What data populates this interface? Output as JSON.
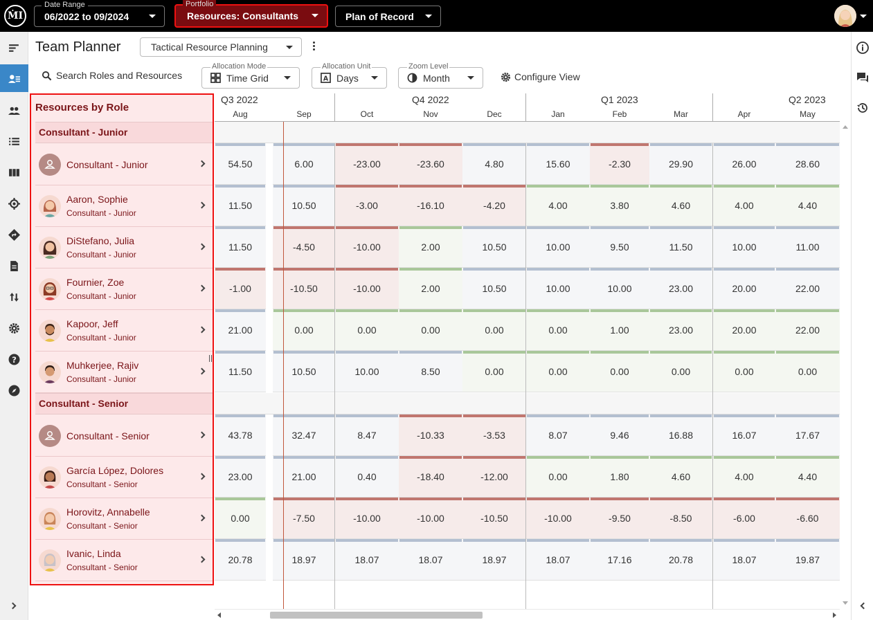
{
  "app": {
    "logo_text": "ṀI"
  },
  "topbar": {
    "date_range": {
      "label": "Date Range",
      "value": "06/2022 to 09/2024"
    },
    "portfolio": {
      "label": "Portfolio",
      "value": "Resources: Consultants"
    },
    "plan": {
      "value": "Plan of Record"
    }
  },
  "header": {
    "title": "Team Planner",
    "view": "Tactical Resource Planning"
  },
  "toolbar": {
    "search_label": "Search Roles and Resources",
    "allocation_mode": {
      "label": "Allocation Mode",
      "value": "Time Grid"
    },
    "allocation_unit": {
      "label": "Allocation Unit",
      "value": "Days"
    },
    "zoom_level": {
      "label": "Zoom Level",
      "value": "Month"
    },
    "configure_label": "Configure View"
  },
  "resources": {
    "title": "Resources by Role",
    "groups": [
      {
        "role": "Consultant - Junior",
        "rows": [
          {
            "name": "Consultant - Junior",
            "role": ""
          },
          {
            "name": "Aaron, Sophie",
            "role": "Consultant - Junior"
          },
          {
            "name": "DiStefano, Julia",
            "role": "Consultant - Junior"
          },
          {
            "name": "Fournier, Zoe",
            "role": "Consultant - Junior"
          },
          {
            "name": "Kapoor, Jeff",
            "role": "Consultant - Junior"
          },
          {
            "name": "Muhkerjee, Rajiv",
            "role": "Consultant - Junior"
          }
        ]
      },
      {
        "role": "Consultant - Senior",
        "rows": [
          {
            "name": "Consultant - Senior",
            "role": ""
          },
          {
            "name": "García López, Dolores",
            "role": "Consultant - Senior"
          },
          {
            "name": "Horovitz, Annabelle",
            "role": "Consultant - Senior"
          },
          {
            "name": "Ivanic, Linda",
            "role": "Consultant - Senior"
          }
        ]
      }
    ]
  },
  "grid": {
    "quarters": [
      "Q3 2022",
      "Q4 2022",
      "Q1 2023",
      "Q2 2023"
    ],
    "months": [
      "Aug",
      "Sep",
      "Oct",
      "Nov",
      "Dec",
      "Jan",
      "Feb",
      "Mar",
      "Apr",
      "May"
    ],
    "colors": {
      "over": "#c0766f",
      "under": "#a9c79a",
      "neutral": "#b3bfd0",
      "over_bg": "#f6ebea",
      "under_bg": "#f4f7f1",
      "neutral_bg": "#f5f6f8"
    },
    "rows": [
      {
        "values": [
          "54.50",
          "6.00",
          "-23.00",
          "-23.60",
          "4.80",
          "15.60",
          "-2.30",
          "29.90",
          "26.00",
          "28.60"
        ],
        "status": [
          "n",
          "n",
          "o",
          "o",
          "n",
          "n",
          "o",
          "n",
          "n",
          "n"
        ]
      },
      {
        "values": [
          "11.50",
          "10.50",
          "-3.00",
          "-16.10",
          "-4.20",
          "4.00",
          "3.80",
          "4.60",
          "4.00",
          "4.40"
        ],
        "status": [
          "n",
          "n",
          "o",
          "o",
          "o",
          "u",
          "u",
          "u",
          "u",
          "u"
        ]
      },
      {
        "values": [
          "11.50",
          "-4.50",
          "-10.00",
          "2.00",
          "10.50",
          "10.00",
          "9.50",
          "11.50",
          "10.00",
          "11.00"
        ],
        "status": [
          "n",
          "o",
          "o",
          "u",
          "n",
          "n",
          "n",
          "n",
          "n",
          "n"
        ]
      },
      {
        "values": [
          "-1.00",
          "-10.50",
          "-10.00",
          "2.00",
          "10.50",
          "10.00",
          "10.00",
          "23.00",
          "20.00",
          "22.00"
        ],
        "status": [
          "o",
          "o",
          "o",
          "u",
          "n",
          "n",
          "n",
          "n",
          "n",
          "n"
        ]
      },
      {
        "values": [
          "21.00",
          "0.00",
          "0.00",
          "0.00",
          "0.00",
          "0.00",
          "1.00",
          "23.00",
          "20.00",
          "22.00"
        ],
        "status": [
          "n",
          "u",
          "u",
          "u",
          "u",
          "u",
          "u",
          "u",
          "u",
          "u"
        ]
      },
      {
        "values": [
          "11.50",
          "10.50",
          "10.00",
          "8.50",
          "0.00",
          "0.00",
          "0.00",
          "0.00",
          "0.00",
          "0.00"
        ],
        "status": [
          "n",
          "n",
          "n",
          "n",
          "u",
          "u",
          "u",
          "u",
          "u",
          "u"
        ]
      },
      {
        "values": [
          "43.78",
          "32.47",
          "8.47",
          "-10.33",
          "-3.53",
          "8.07",
          "9.46",
          "16.88",
          "16.07",
          "17.67"
        ],
        "status": [
          "n",
          "n",
          "n",
          "o",
          "o",
          "n",
          "n",
          "n",
          "n",
          "n"
        ]
      },
      {
        "values": [
          "23.00",
          "21.00",
          "0.40",
          "-18.40",
          "-12.00",
          "0.00",
          "1.80",
          "4.60",
          "4.00",
          "4.40"
        ],
        "status": [
          "n",
          "n",
          "n",
          "o",
          "o",
          "u",
          "u",
          "u",
          "u",
          "u"
        ]
      },
      {
        "values": [
          "0.00",
          "-7.50",
          "-10.00",
          "-10.00",
          "-10.50",
          "-10.00",
          "-9.50",
          "-8.50",
          "-6.00",
          "-6.60"
        ],
        "status": [
          "u",
          "o",
          "o",
          "o",
          "o",
          "o",
          "o",
          "o",
          "o",
          "o"
        ]
      },
      {
        "values": [
          "20.78",
          "18.97",
          "18.07",
          "18.07",
          "18.97",
          "18.07",
          "17.16",
          "20.78",
          "18.07",
          "19.87"
        ],
        "status": [
          "n",
          "n",
          "n",
          "n",
          "n",
          "n",
          "n",
          "n",
          "n",
          "n"
        ]
      }
    ]
  }
}
